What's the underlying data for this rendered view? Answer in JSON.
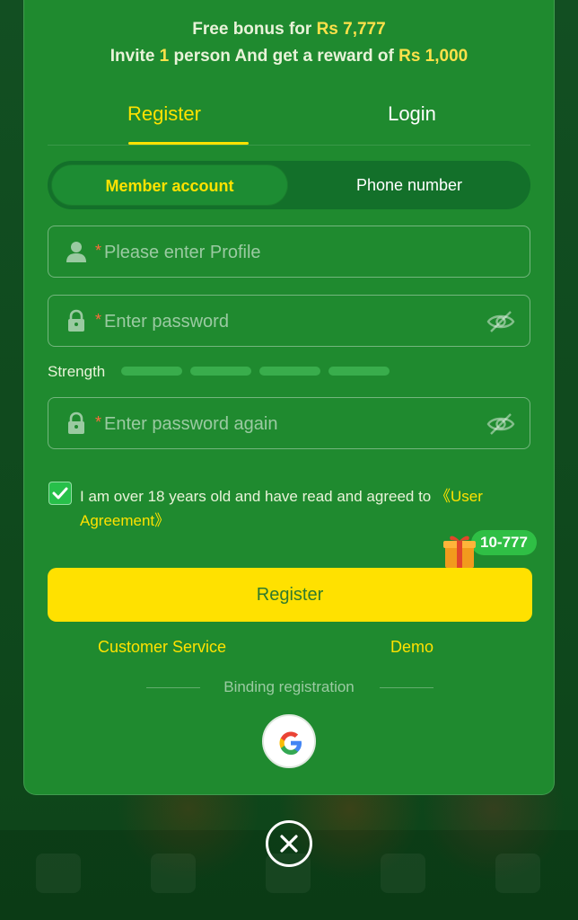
{
  "promo": {
    "line1_prefix": "Free bonus for",
    "line1_amount": "Rs 7,777",
    "line2_prefix": "Invite",
    "line2_count": "1",
    "line2_middle": "person And get a reward of",
    "line2_amount": "Rs 1,000"
  },
  "tabs": {
    "register": "Register",
    "login": "Login",
    "active": "Register"
  },
  "segment": {
    "member": "Member account",
    "phone": "Phone number",
    "selected": "Member account"
  },
  "form": {
    "required_mark": "*",
    "profile": {
      "placeholder": "Please enter Profile",
      "value": "",
      "icon": "user-icon"
    },
    "password": {
      "placeholder": "Enter password",
      "value": "",
      "icon": "lock-icon",
      "toggle_icon": "eye-off-icon"
    },
    "strength_label": "Strength",
    "strength_level": 0,
    "password_again": {
      "placeholder": "Enter password again",
      "value": "",
      "icon": "lock-icon",
      "toggle_icon": "eye-off-icon"
    }
  },
  "agreement": {
    "checked": true,
    "text": "I am over 18 years old and have read and agreed to ",
    "link": "《User Agreement》"
  },
  "gift": {
    "icon": "gift-icon",
    "badge": "10-777"
  },
  "register_button": "Register",
  "links": {
    "customer_service": "Customer Service",
    "demo": "Demo"
  },
  "binding": {
    "label": "Binding registration",
    "google_icon": "google-icon"
  },
  "close_icon": "close-icon",
  "colors": {
    "modal_bg": "#1f8a2f",
    "accent_yellow": "#ffe200",
    "button_yellow": "#ffe100",
    "required_red": "#ff6a3b"
  }
}
